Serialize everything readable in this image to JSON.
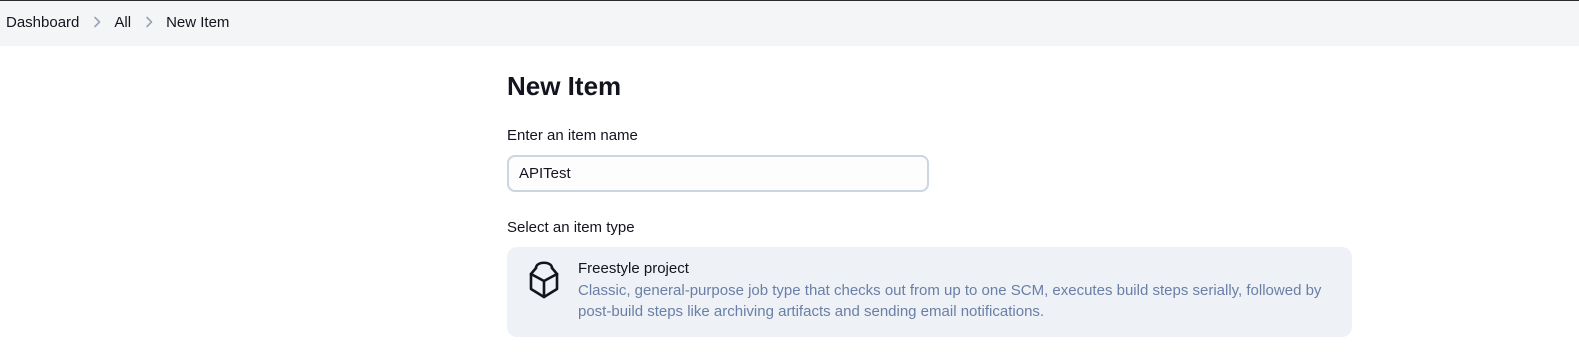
{
  "breadcrumb": {
    "items": [
      {
        "label": "Dashboard"
      },
      {
        "label": "All"
      },
      {
        "label": "New Item"
      }
    ]
  },
  "page": {
    "title": "New Item"
  },
  "item_name": {
    "label": "Enter an item name",
    "value": "APITest"
  },
  "item_type": {
    "label": "Select an item type",
    "options": [
      {
        "title": "Freestyle project",
        "description": "Classic, general-purpose job type that checks out from up to one SCM, executes build steps serially, followed by post-build steps like archiving artifacts and sending email notifications.",
        "icon": "freestyle-cube-icon"
      }
    ]
  },
  "colors": {
    "breadcrumb_bg": "#f4f5f7",
    "card_bg": "#eef1f6",
    "description_text": "#6a7fa6",
    "input_border": "#cdd4e2"
  }
}
